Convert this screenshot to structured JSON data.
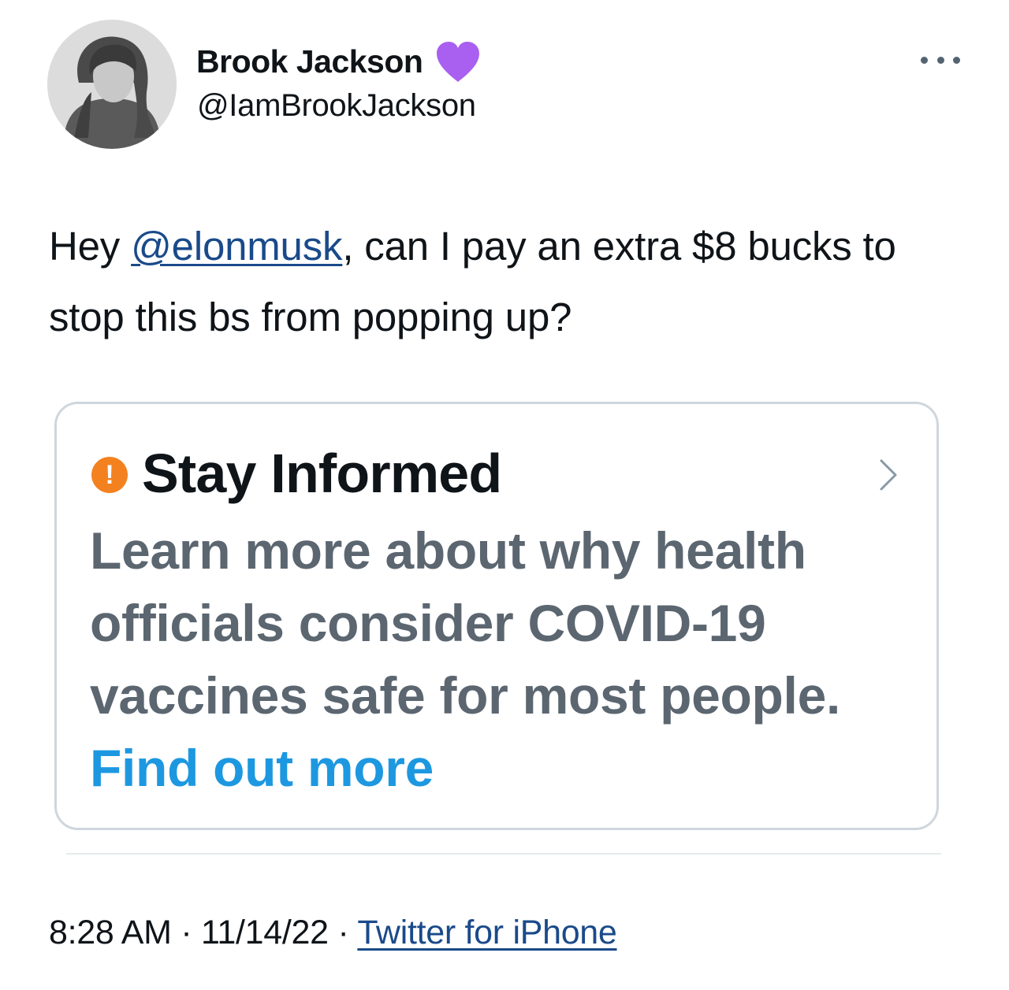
{
  "author": {
    "display_name": "Brook Jackson",
    "handle": "@IamBrookJackson",
    "badge_icon": "purple-heart-icon",
    "badge_color": "#a95ff0"
  },
  "tweet": {
    "text_before": "Hey ",
    "mention": "@elonmusk",
    "text_after": ", can I pay an extra $8 bucks to stop this bs from popping up?"
  },
  "notice_card": {
    "icon": "alert-icon",
    "icon_glyph": "!",
    "icon_color": "#f4811f",
    "title": "Stay Informed",
    "body": "Learn more about why health officials consider COVID-19 vaccines safe for most people.",
    "link": "Find out more",
    "link_color": "#1d98e0"
  },
  "meta": {
    "time": "8:28 AM",
    "separator": " · ",
    "date": "11/14/22",
    "source": "Twitter for iPhone"
  }
}
